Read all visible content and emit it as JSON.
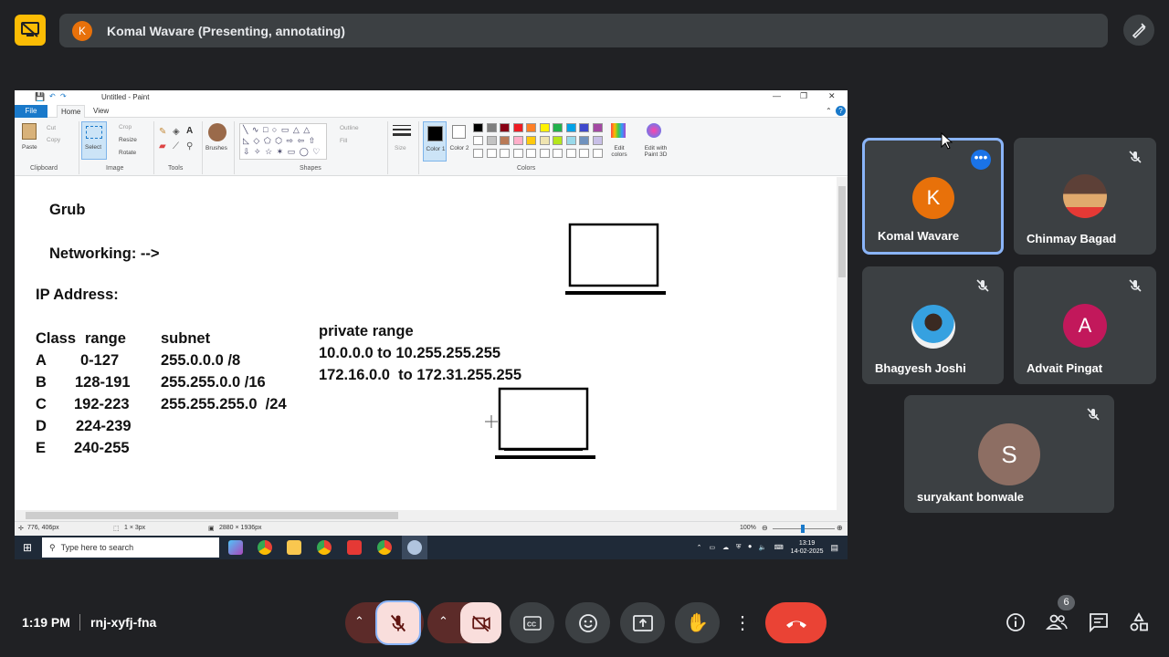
{
  "topbar": {
    "presenter_initial": "K",
    "presenting_text": "Komal Wavare (Presenting, annotating)"
  },
  "paint": {
    "window_title": "Untitled - Paint",
    "tabs": {
      "file": "File",
      "home": "Home",
      "view": "View"
    },
    "ribbon": {
      "paste": "Paste",
      "cut": "Cut",
      "copy": "Copy",
      "select": "Select",
      "crop": "Crop",
      "resize": "Resize",
      "rotate": "Rotate",
      "brushes": "Brushes",
      "outline": "Outline",
      "fill": "Fill",
      "size": "Size",
      "color1": "Color 1",
      "color2": "Color 2",
      "edit_colors": "Edit colors",
      "edit_3d": "Edit with Paint 3D",
      "groups": {
        "clipboard": "Clipboard",
        "image": "Image",
        "tools": "Tools",
        "shapes": "Shapes",
        "colors": "Colors"
      }
    },
    "palette": [
      "#000000",
      "#7f7f7f",
      "#880015",
      "#ed1c24",
      "#ff7f27",
      "#fff200",
      "#22b14c",
      "#00a2e8",
      "#3f48cc",
      "#a349a4",
      "#ffffff",
      "#c3c3c3",
      "#b97a57",
      "#ffaec9",
      "#ffc90e",
      "#efe4b0",
      "#b5e61d",
      "#99d9ea",
      "#7092be",
      "#c8bfe7"
    ],
    "canvas_text": {
      "grub": "Grub",
      "networking": "Networking: -->",
      "ip_address": "IP Address:",
      "col_class": "Class",
      "col_range": "range",
      "col_subnet": "subnet",
      "rows": [
        {
          "cls": "A",
          "range": "0-127",
          "subnet": "255.0.0.0 /8"
        },
        {
          "cls": "B",
          "range": "128-191",
          "subnet": "255.255.0.0 /16"
        },
        {
          "cls": "C",
          "range": "192-223",
          "subnet": "255.255.255.0  /24"
        },
        {
          "cls": "D",
          "range": "224-239",
          "subnet": ""
        },
        {
          "cls": "E",
          "range": "240-255",
          "subnet": ""
        }
      ],
      "private_title": "private range",
      "private_1": "10.0.0.0 to 10.255.255.255",
      "private_2": "172.16.0.0  to 172.31.255.255"
    },
    "status": {
      "cursor_pos": "776, 406px",
      "selection": "1 × 3px",
      "image_size": "2880 × 1936px",
      "zoom": "100%"
    },
    "taskbar": {
      "search_placeholder": "Type here to search",
      "time": "13:19",
      "date": "14-02-2025"
    }
  },
  "participants": [
    {
      "name": "Komal Wavare",
      "initial": "K",
      "color": "#e8710a",
      "active": true
    },
    {
      "name": "Chinmay Bagad",
      "initial": "",
      "color": "#c9a27e",
      "muted": true
    },
    {
      "name": "Bhagyesh Joshi",
      "initial": "",
      "color": "#5aa0d8",
      "muted": true
    },
    {
      "name": "Advait Pingat",
      "initial": "A",
      "color": "#c2185b",
      "muted": true
    },
    {
      "name": "suryakant bonwale",
      "initial": "S",
      "color": "#8d6e63",
      "muted": true
    }
  ],
  "bottombar": {
    "time": "1:19 PM",
    "meeting_code": "rnj-xyfj-fna",
    "people_count": "6",
    "colors": {
      "danger": "#ea4335",
      "mic_off_bg": "#f9dedc",
      "control_bg": "#3c4043"
    }
  }
}
